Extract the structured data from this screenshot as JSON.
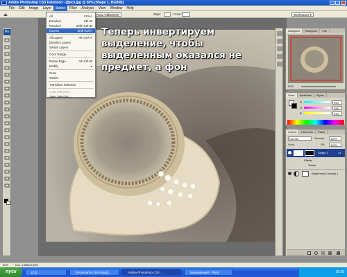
{
  "window": {
    "title": "Adobe Photoshop CS3 Extended - [Диск.jpg @ 50% (Shape 1, RGB/8)]"
  },
  "menubar": [
    "File",
    "Edit",
    "Image",
    "Layer",
    "Select",
    "Filter",
    "Analysis",
    "View",
    "Window",
    "Help"
  ],
  "active_menu": "Select",
  "options_bar": {
    "auto_add_delete": "Auto Add/Delete",
    "style_label": "Style:",
    "color_label": "Color:",
    "workspace": "Workspace ▾"
  },
  "select_menu": [
    {
      "label": "All",
      "shortcut": "Ctrl+A",
      "state": "normal"
    },
    {
      "label": "Deselect",
      "shortcut": "Ctrl+D",
      "state": "normal"
    },
    {
      "label": "Reselect",
      "shortcut": "Shift+Ctrl+D",
      "state": "normal"
    },
    {
      "label": "Inverse",
      "shortcut": "Shift+Ctrl+I",
      "state": "highlighted"
    },
    {
      "label": "All Layers",
      "shortcut": "Alt+Ctrl+A",
      "state": "normal"
    },
    {
      "label": "Deselect Layers",
      "shortcut": "",
      "state": "normal"
    },
    {
      "label": "Similar Layers",
      "shortcut": "",
      "state": "normal"
    },
    {
      "label": "Color Range...",
      "shortcut": "",
      "state": "normal"
    },
    {
      "label": "Refine Edge...",
      "shortcut": "Alt+Ctrl+R",
      "state": "normal"
    },
    {
      "label": "Modify",
      "shortcut": "▸",
      "state": "normal"
    },
    {
      "label": "Grow",
      "shortcut": "",
      "state": "normal"
    },
    {
      "label": "Similar",
      "shortcut": "",
      "state": "normal"
    },
    {
      "label": "Transform Selection",
      "shortcut": "",
      "state": "normal"
    },
    {
      "label": "Load Selection...",
      "shortcut": "",
      "state": "disabled"
    },
    {
      "label": "Save Selection...",
      "shortcut": "",
      "state": "normal"
    }
  ],
  "caption": "Теперь инвертируем выделение, чтобы выделенным оказался не предмет, а фон",
  "tools_logo": "Ps",
  "navigator": {
    "tabs": [
      "Navigator",
      "Histogram",
      "Info"
    ],
    "zoom": "50%"
  },
  "color_panel": {
    "tabs": [
      "Color",
      "Swatches",
      "Styles"
    ],
    "channels": [
      {
        "name": "R",
        "value": "255"
      },
      {
        "name": "G",
        "value": "255"
      },
      {
        "name": "B",
        "value": "255"
      }
    ]
  },
  "layers_panel": {
    "tabs": [
      "Layers",
      "Channels",
      "Paths"
    ],
    "blend_mode": "Normal",
    "opacity_label": "Opacity:",
    "opacity": "100%",
    "lock_label": "Lock:",
    "fill_label": "Fill:",
    "fill": "100%",
    "layers": [
      {
        "name": "Shape 1",
        "selected": true,
        "effects": [
          "Effects",
          "Stroke"
        ]
      },
      {
        "name": "Brightness/Contrast 1",
        "selected": false,
        "effects": []
      }
    ]
  },
  "status_bar": {
    "zoom": "50%",
    "doc": "Doc: 4,89M/4,89M"
  },
  "taskbar": {
    "start": "пуск",
    "tasks": [
      {
        "label": "ICQ",
        "active": false
      },
      {
        "label": "В Контакте | Фотограф...",
        "active": false
      },
      {
        "label": "Adobe Photoshop CS3 ...",
        "active": true
      },
      {
        "label": "Безымянный - Paint",
        "active": false
      }
    ],
    "clock": "18:28"
  },
  "colors": {
    "menu_highlight": "#316ac5",
    "taskbar": "#245edb",
    "start": "#3c9a37",
    "selected_layer": "#1f3f8f",
    "photoshop_bg": "#8f8f8f"
  }
}
